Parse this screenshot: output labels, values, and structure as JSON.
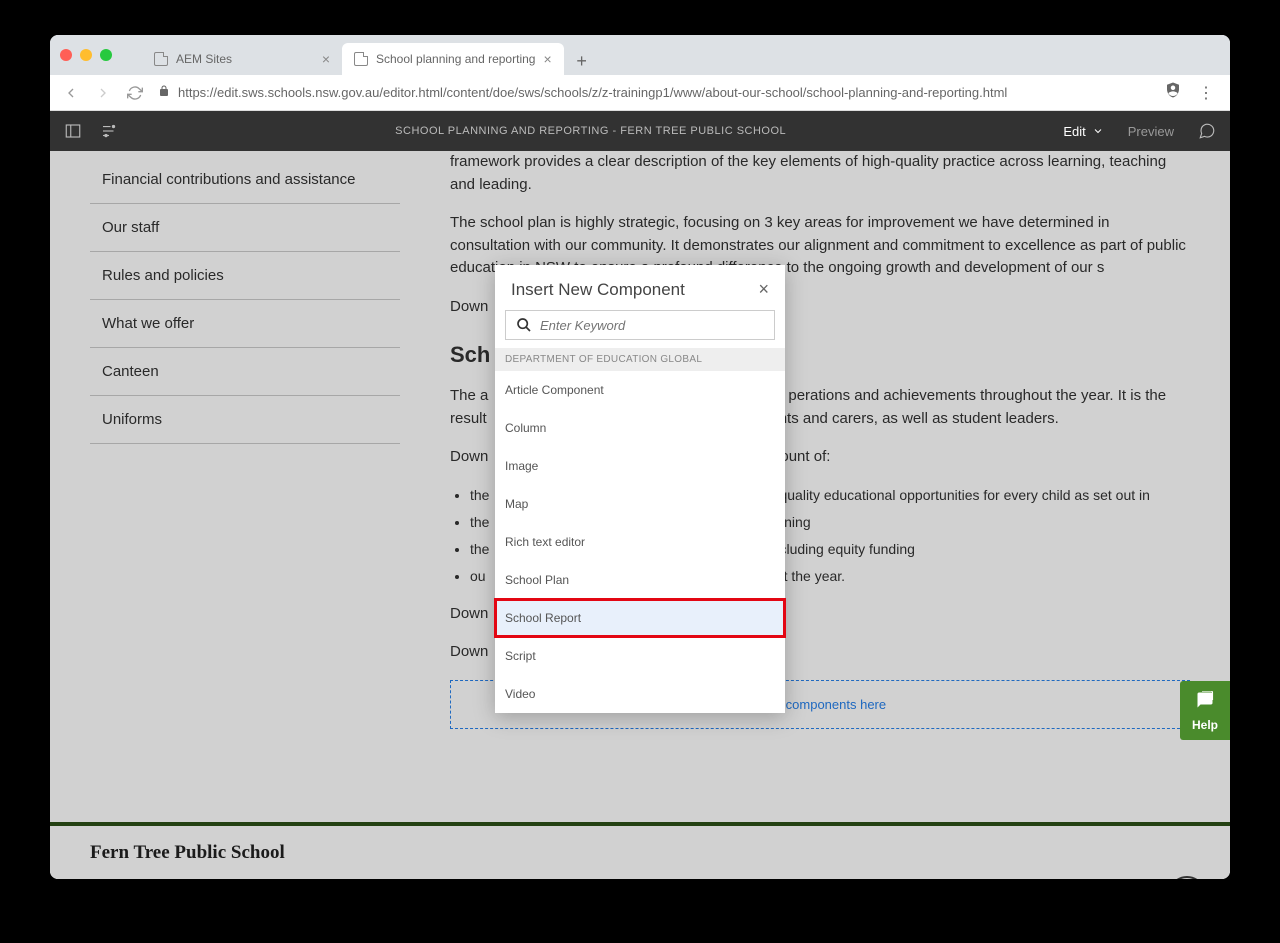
{
  "browser": {
    "tabs": [
      {
        "label": "AEM Sites",
        "active": false
      },
      {
        "label": "School planning and reporting",
        "active": true
      }
    ],
    "url": "https://edit.sws.schools.nsw.gov.au/editor.html/content/doe/sws/schools/z/z-trainingp1/www/about-our-school/school-planning-and-reporting.html"
  },
  "aem": {
    "title": "SCHOOL PLANNING AND REPORTING - FERN TREE PUBLIC SCHOOL",
    "edit": "Edit",
    "preview": "Preview"
  },
  "sidebar": {
    "items": [
      "Financial contributions and assistance",
      "Our staff",
      "Rules and policies",
      "What we offer",
      "Canteen",
      "Uniforms"
    ]
  },
  "main": {
    "p1": "framework provides a clear description of the key elements of high-quality practice across learning, teaching and leading.",
    "p2": "The school plan is highly strategic, focusing on 3 key areas for improvement we have determined in consultation with our community. It demonstrates our alignment and commitment to excellence as part of public education in NSW to ensure a profound difference to the ongoing growth and development of our s",
    "p3": "Down",
    "h2": "Sch",
    "p4": "The a",
    "p4b": "perations and achievements throughout the year. It is the",
    "p5": "result",
    "p5b": "nts and carers, as well as student leaders.",
    "p6": "Down",
    "p6b": "ount of:",
    "li1": "the",
    "li1b": "quality educational opportunities for every child as set out in",
    "li2": "the",
    "li2b": "rning",
    "li3": "the",
    "li3b": "cluding equity funding",
    "li4": "ou",
    "li4b": "t the year.",
    "p7": "Down",
    "p8": "Down",
    "drop": "Drag components here"
  },
  "dialog": {
    "title": "Insert New Component",
    "search_placeholder": "Enter Keyword",
    "group": "DEPARTMENT OF EDUCATION GLOBAL",
    "items": [
      "Article Component",
      "Column",
      "Image",
      "Map",
      "Rich text editor",
      "School Plan",
      "School Report",
      "Script",
      "Video"
    ]
  },
  "help": {
    "label": "Help"
  },
  "footer": {
    "title": "Fern Tree Public School"
  }
}
